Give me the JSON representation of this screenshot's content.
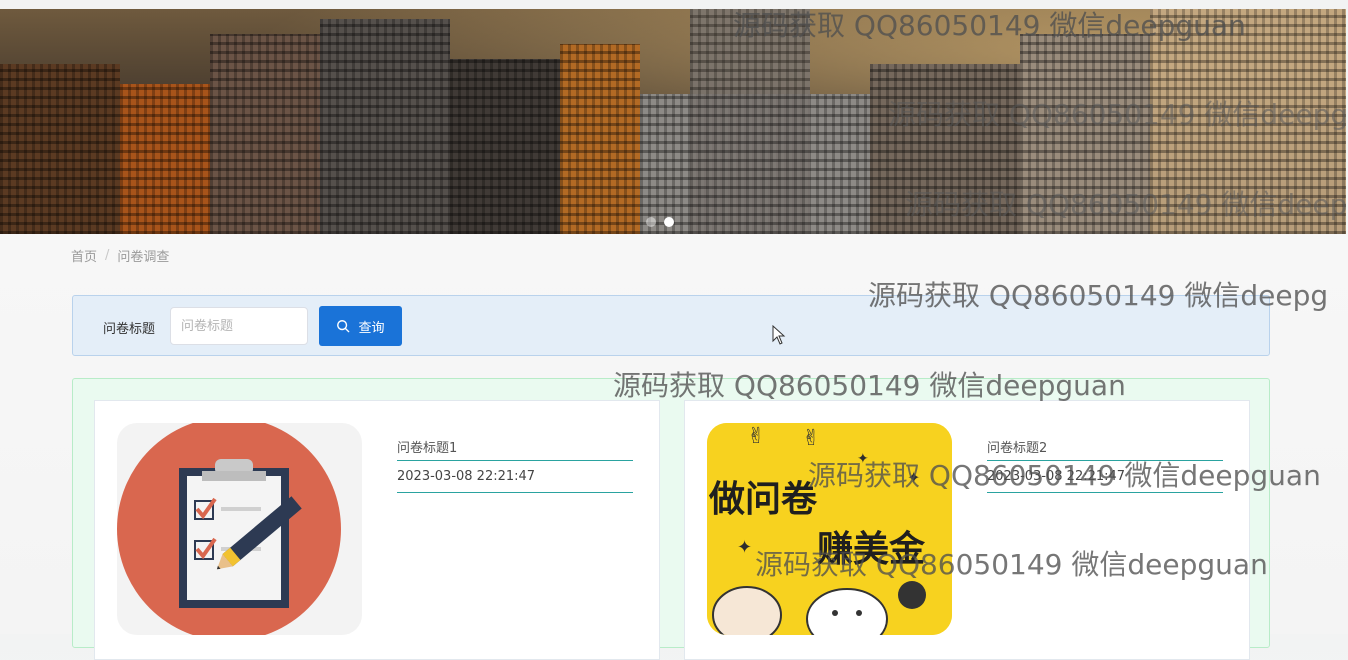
{
  "breadcrumb": {
    "home": "首页",
    "current": "问卷调查"
  },
  "search": {
    "label": "问卷标题",
    "placeholder": "问卷标题",
    "button": "查询"
  },
  "cards": [
    {
      "title": "问卷标题1",
      "date": "2023-03-08 22:21:47",
      "image": "clipboard-checklist-icon"
    },
    {
      "title": "问卷标题2",
      "date": "2023-03-08 22:21:47",
      "image": "survey-poster-image",
      "poster_text_1": "做问卷",
      "poster_text_2": "赚美金"
    }
  ],
  "carousel": {
    "active_index": 1,
    "count": 2
  },
  "watermarks": [
    "源码获取 QQ86050149 微信deepguan",
    "源码获取 QQ86050149 微信deepg",
    "源码获取 QQ86050149 微信deep",
    "源码获取 QQ86050149 微信deepg",
    "源码获取 QQ86050149 微信deepguan",
    "源码获取 QQ86050149 微信deepguan",
    "源码获取 QQ86050149 微信deepguan"
  ],
  "colors": {
    "primary": "#1a73d8",
    "search_bg": "#e4eef8",
    "list_bg": "#eafaf0",
    "divider": "#2aa3a0"
  }
}
